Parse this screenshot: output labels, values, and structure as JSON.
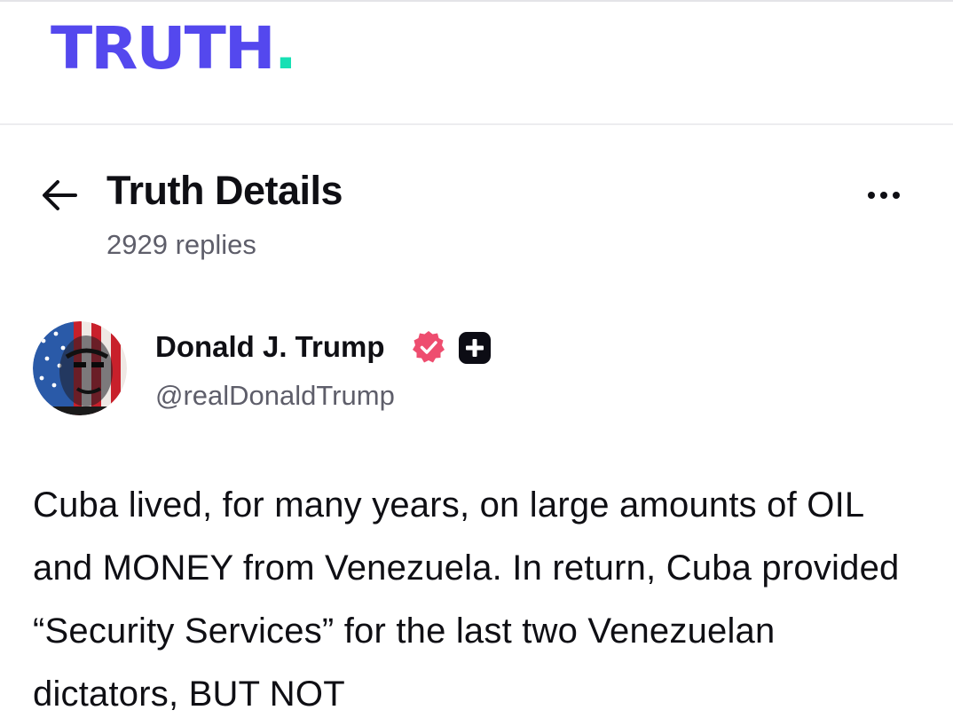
{
  "app": {
    "logo_text": "TRUTH",
    "logo_dot": ".",
    "brand_color": "#5448ee",
    "accent_color": "#17e0b4"
  },
  "header": {
    "back_icon": "arrow-left-icon",
    "title": "Truth Details",
    "reply_count": "2929 replies",
    "more_icon": "ellipsis-horizontal-icon"
  },
  "post": {
    "author": {
      "display_name": "Donald J. Trump",
      "handle": "@realDonaldTrump",
      "verified_icon": "verified-badge-icon",
      "verified_color": "#ee4d6f",
      "plus_icon": "plus-badge-icon"
    },
    "text": "Cuba lived, for many years, on large amounts of OIL and MONEY from Venezuela. In return, Cuba provided “Security Services” for the last two Venezuelan dictators, BUT NOT"
  }
}
